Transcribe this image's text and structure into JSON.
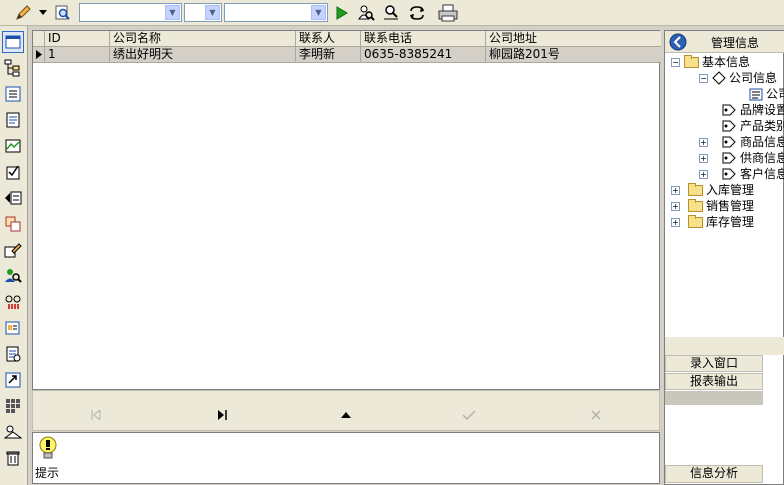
{
  "toolbar": {
    "icons": [
      "pencil-icon",
      "dropdown-arrow-icon",
      "magnifier-icon",
      "play-icon",
      "find-user-icon",
      "find-record-icon",
      "refresh-icon",
      "print-icon"
    ],
    "combos": [
      {
        "value": ""
      },
      {
        "value": ""
      },
      {
        "value": ""
      }
    ]
  },
  "sidebar_icons": [
    "window-icon",
    "hierarchy-icon",
    "list-icon",
    "document-icon",
    "chart-icon",
    "checkbox-icon",
    "record-arrow-icon",
    "layers-icon",
    "edit-user-icon",
    "user-search-icon",
    "link-icon",
    "card-icon",
    "report-icon",
    "export-icon",
    "grid-icon",
    "settings-hand-icon",
    "trash-icon"
  ],
  "grid": {
    "columns": [
      "ID",
      "公司名称",
      "联系人",
      "联系电话",
      "公司地址"
    ],
    "rows": [
      [
        "1",
        "绣出好明天",
        "李明新",
        "0635-8385241",
        "柳园路201号"
      ]
    ]
  },
  "hint": {
    "label": "提示"
  },
  "panel": {
    "title": "管理信息",
    "tree": [
      {
        "label": "基本信息"
      },
      {
        "label": "公司信息"
      },
      {
        "label": "公司"
      },
      {
        "label": "品牌设置"
      },
      {
        "label": "产品类别"
      },
      {
        "label": "商品信息"
      },
      {
        "label": "供商信息"
      },
      {
        "label": "客户信息"
      },
      {
        "label": "入库管理"
      },
      {
        "label": "销售管理"
      },
      {
        "label": "库存管理"
      }
    ],
    "buttons": {
      "entry": "录入窗口",
      "report": "报表输出",
      "analysis": "信息分析"
    }
  },
  "colors": {
    "selection": "#316ac5",
    "header_bg": "#ece9d8",
    "play": "#1e9e1e"
  }
}
